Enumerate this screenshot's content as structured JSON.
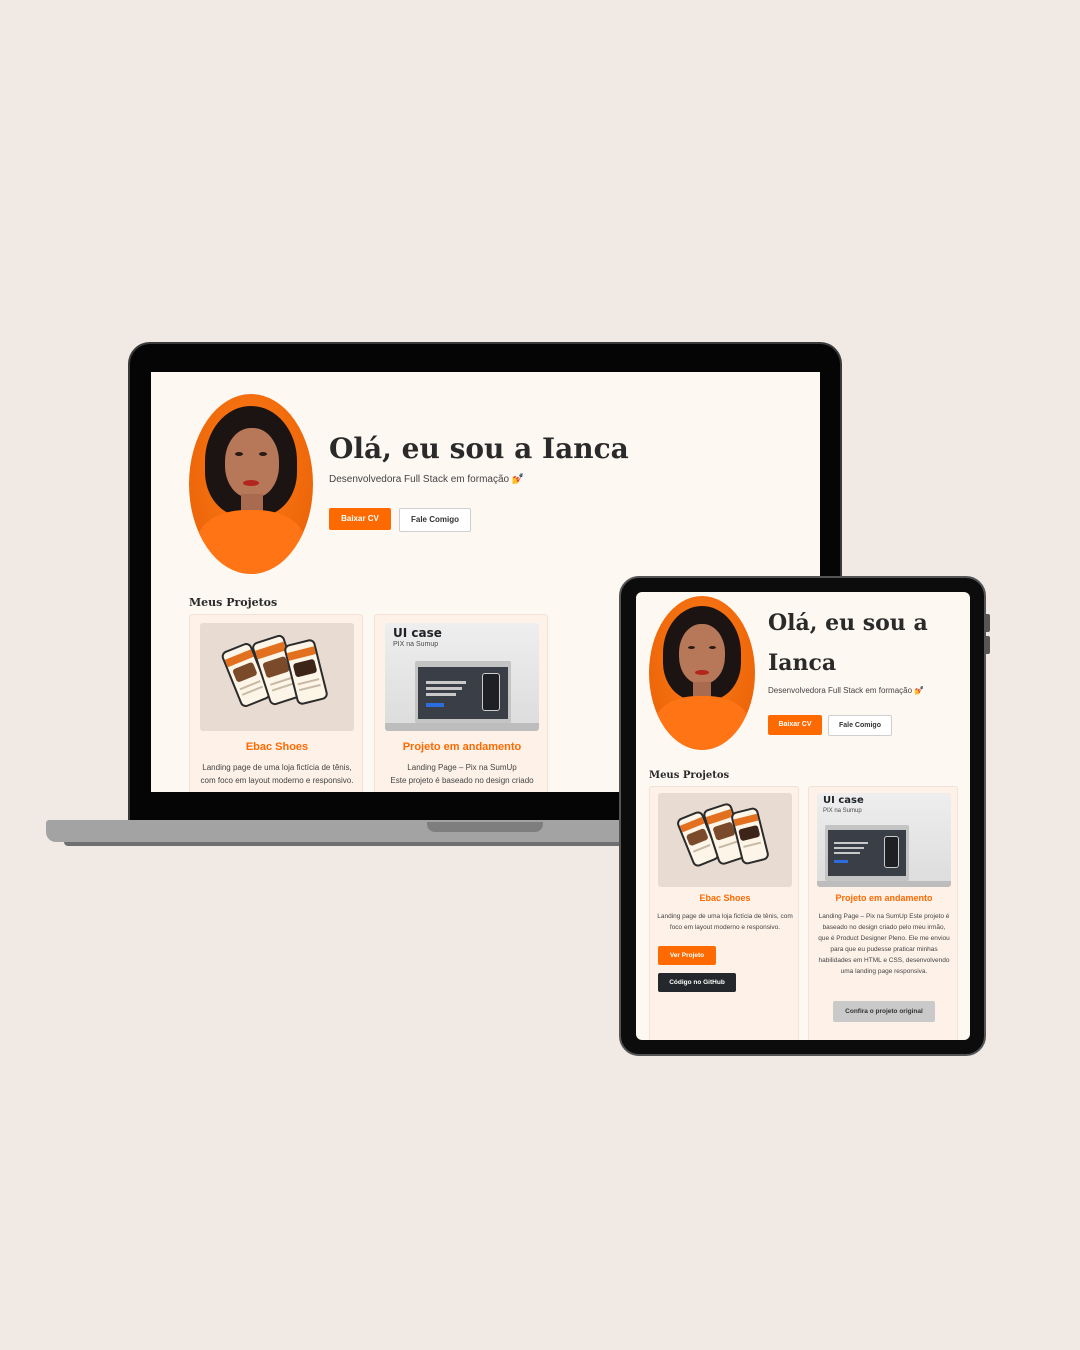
{
  "hero": {
    "title_desktop": "Olá, eu sou a Ianca",
    "title_tablet_line1": "Olá, eu sou a",
    "title_tablet_line2": "Ianca",
    "subtitle": "Desenvolvedora Full Stack em formação 💅"
  },
  "buttons": {
    "download_cv": "Baixar CV",
    "contact": "Fale Comigo"
  },
  "projects": {
    "section_title": "Meus Projetos",
    "items": [
      {
        "title": "Ebac Shoes",
        "description": "Landing page de uma loja fictícia de tênis, com foco em layout moderno e responsivo.",
        "view_label": "Ver Projeto",
        "github_label": "Código no GitHub"
      },
      {
        "title": "Projeto em andamento",
        "image_title": "UI case",
        "image_subtitle": "PIX na Sumup",
        "description": "Landing Page – Pix na SumUp Este projeto é baseado no design criado pelo meu irmão, que é Product Designer Pleno. Ele me enviou para que eu pudesse praticar minhas habilidades em HTML e CSS, desenvolvendo uma landing page responsiva.",
        "description_desktop_line1": "Landing Page – Pix na SumUp",
        "description_desktop_line2": "Este projeto é baseado no design criado",
        "original_label": "Confira o projeto original"
      }
    ]
  },
  "colors": {
    "accent": "#ff6a00",
    "page_background": "#fdf8f2",
    "card_background": "#fdf1e8",
    "dark_button": "#24272b"
  }
}
